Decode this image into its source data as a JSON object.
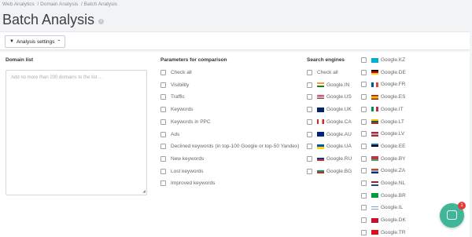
{
  "breadcrumb": [
    "Web Analytics",
    "/ Domain Analysis",
    "/ Batch Analysis"
  ],
  "title": "Batch Analysis",
  "toolbar": {
    "settings_label": "Analysis settings"
  },
  "domain_list": {
    "label": "Domain list",
    "placeholder": "Add no more than 200 domains to the list ..."
  },
  "parameters": {
    "label": "Parameters for comparison",
    "items": [
      "Check all",
      "Visibility",
      "Traffic",
      "Keywords",
      "Keywords in PPC",
      "Ads",
      "Declined keywords (in top-100 Google or top-50 Yandex)",
      "New keywords",
      "Lost keywords",
      "Improved keywords"
    ]
  },
  "search_engines": {
    "label": "Search engines",
    "col1": [
      {
        "label": "Check all",
        "flag": null
      },
      {
        "label": "Google.IN",
        "flag": "in"
      },
      {
        "label": "Google.US",
        "flag": "us"
      },
      {
        "label": "Google.UK",
        "flag": "uk"
      },
      {
        "label": "Google.CA",
        "flag": "ca"
      },
      {
        "label": "Google.AU",
        "flag": "au"
      },
      {
        "label": "Google.UA",
        "flag": "ua"
      },
      {
        "label": "Google.RU",
        "flag": "ru"
      },
      {
        "label": "Google.BG",
        "flag": "bg"
      }
    ],
    "col2": [
      {
        "label": "Google.KZ",
        "flag": "kz"
      },
      {
        "label": "Google.DE",
        "flag": "de"
      },
      {
        "label": "Google.FR",
        "flag": "fr"
      },
      {
        "label": "Google.ES",
        "flag": "es"
      },
      {
        "label": "Google.IT",
        "flag": "it"
      },
      {
        "label": "Google.LT",
        "flag": "lt"
      },
      {
        "label": "Google.LV",
        "flag": "lv"
      },
      {
        "label": "Google.EE",
        "flag": "ee"
      },
      {
        "label": "Google.BY",
        "flag": "by"
      },
      {
        "label": "Google.ZA",
        "flag": "za"
      },
      {
        "label": "Google.NL",
        "flag": "nl"
      },
      {
        "label": "Google.BR",
        "flag": "br"
      },
      {
        "label": "Google.IL",
        "flag": "il"
      },
      {
        "label": "Google.DK",
        "flag": "dk"
      },
      {
        "label": "Google.TR",
        "flag": "tr"
      }
    ]
  },
  "chat": {
    "badge": "1"
  }
}
